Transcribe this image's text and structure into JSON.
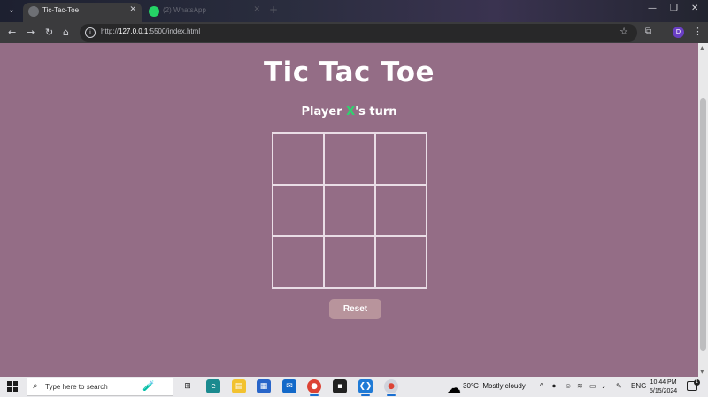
{
  "browser": {
    "tabs": [
      {
        "title": "Tic-Tac-Toe",
        "active": true
      },
      {
        "title": "(2) WhatsApp",
        "active": false
      }
    ],
    "new_tab": "+",
    "window_controls": {
      "minimize": "—",
      "restore": "❐",
      "close": "✕"
    },
    "nav": {
      "back": "←",
      "forward": "→",
      "reload": "↻",
      "home": "⌂"
    },
    "url_prefix": "http://",
    "url_host": "127.0.0.1",
    "url_rest": ":5500/index.html",
    "profile_initial": "D"
  },
  "game": {
    "title": "Tic Tac Toe",
    "status_prefix": "Player ",
    "status_player": "X",
    "status_suffix": "'s turn",
    "cells": [
      "",
      "",
      "",
      "",
      "",
      "",
      "",
      "",
      ""
    ],
    "reset_label": "Reset"
  },
  "taskbar": {
    "search_placeholder": "Type here to search",
    "weather_temp": "30°C",
    "weather_desc": "Mostly cloudy",
    "language": "ENG",
    "time": "10:44 PM",
    "date": "5/15/2024",
    "notification_count": "1"
  },
  "colors": {
    "page_background": "#946d86",
    "title_text": "#ffffff",
    "player_x": "#2fd36f",
    "reset_button": "#b8949c",
    "grid_lines": "#e9dde6"
  }
}
